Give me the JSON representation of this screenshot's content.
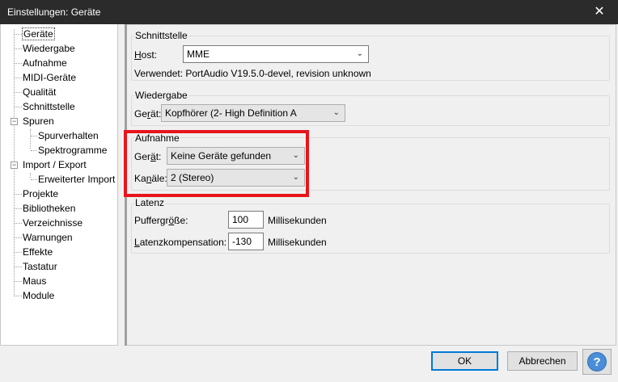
{
  "window": {
    "title": "Einstellungen: Geräte",
    "close_glyph": "✕"
  },
  "tree": {
    "items": [
      {
        "label": "Geräte",
        "selected": true
      },
      {
        "label": "Wiedergabe"
      },
      {
        "label": "Aufnahme"
      },
      {
        "label": "MIDI-Geräte"
      },
      {
        "label": "Qualität"
      },
      {
        "label": "Schnittstelle"
      },
      {
        "label": "Spuren",
        "expander": "−"
      },
      {
        "label": "Spurverhalten"
      },
      {
        "label": "Spektrogramme"
      },
      {
        "label": "Import / Export",
        "expander": "−"
      },
      {
        "label": "Erweiterter Import"
      },
      {
        "label": "Projekte"
      },
      {
        "label": "Bibliotheken"
      },
      {
        "label": "Verzeichnisse"
      },
      {
        "label": "Warnungen"
      },
      {
        "label": "Effekte"
      },
      {
        "label": "Tastatur"
      },
      {
        "label": "Maus"
      },
      {
        "label": "Module"
      }
    ]
  },
  "schnittstelle": {
    "title": "Schnittstelle",
    "host_label_u": "H",
    "host_label_rest": "ost:",
    "host_value": "MME",
    "using_text": "Verwendet: PortAudio V19.5.0-devel, revision unknown"
  },
  "wiedergabe": {
    "title": "Wiedergabe",
    "device_label_pre": "Ge",
    "device_label_u": "r",
    "device_label_post": "ät:",
    "device_value": "Kopfhörer (2- High Definition A"
  },
  "aufnahme": {
    "title": "Aufnahme",
    "device_label_pre": "Ger",
    "device_label_u": "ä",
    "device_label_post": "t:",
    "device_value": "Keine Geräte gefunden",
    "channels_label_pre": "Ka",
    "channels_label_u": "n",
    "channels_label_post": "äle:",
    "channels_value": "2 (Stereo)"
  },
  "latenz": {
    "title": "Latenz",
    "buffer_label_pre": "Puffergr",
    "buffer_label_u": "ö",
    "buffer_label_post": "ße:",
    "buffer_value": "100",
    "buffer_unit": "Millisekunden",
    "comp_label_pre": "",
    "comp_label_u": "L",
    "comp_label_post": "atenzkompensation:",
    "comp_value": "-130",
    "comp_unit": "Millisekunden"
  },
  "buttons": {
    "ok": "OK",
    "cancel": "Abbrechen",
    "help": "?"
  },
  "colors": {
    "highlight": "#e8141c",
    "titlebar": "#2b2b2b",
    "default_button": "#0078d7"
  }
}
